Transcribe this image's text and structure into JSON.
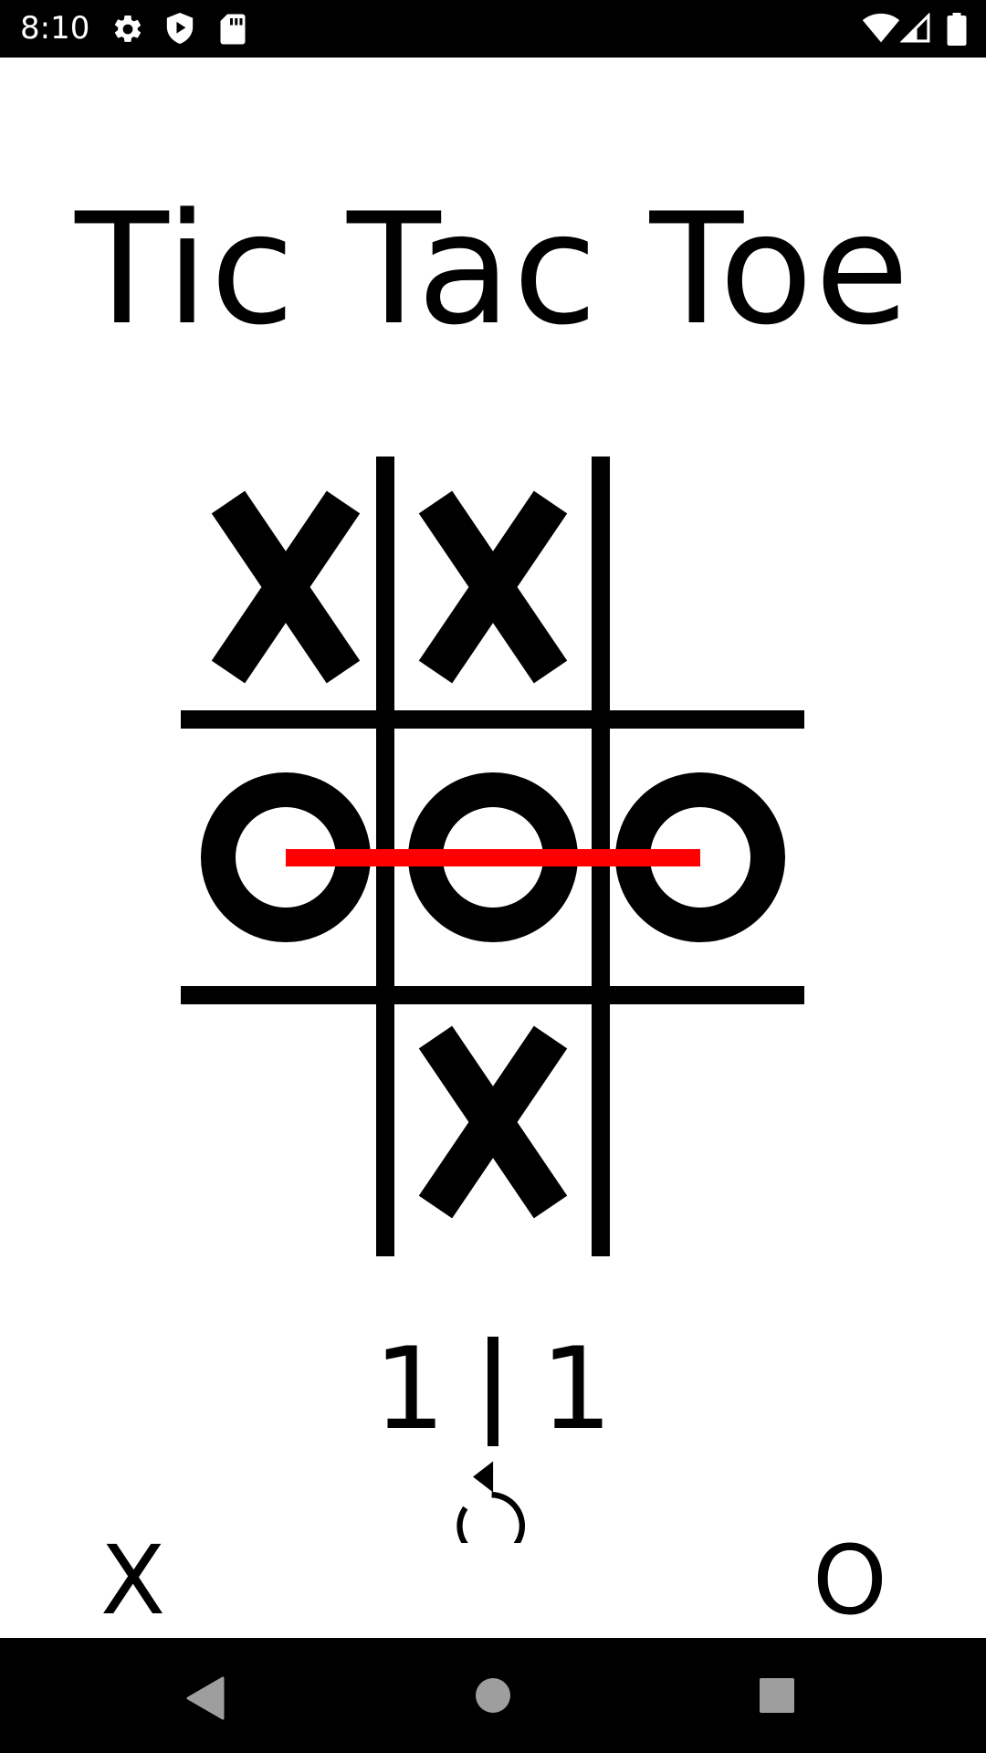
{
  "status_bar": {
    "time": "8:10",
    "icons": [
      "gear-icon",
      "shield-play-icon",
      "sd-card-icon",
      "wifi-icon",
      "signal-icon",
      "battery-icon"
    ]
  },
  "title": "Tic Tac Toe",
  "board": {
    "cells": [
      [
        "X",
        "X",
        ""
      ],
      [
        "O",
        "O",
        "O"
      ],
      [
        "",
        "X",
        ""
      ]
    ],
    "winning_line": "middle-row",
    "win_line_color": "#ff0000",
    "grid_color": "#000000"
  },
  "score": {
    "x": "1",
    "o": "1"
  },
  "controls": {
    "restart_icon": "restart-icon"
  },
  "players": {
    "x_label": "X",
    "o_label": "O"
  },
  "nav_bar": {
    "icons": [
      "back-icon",
      "home-icon",
      "recents-icon"
    ]
  }
}
